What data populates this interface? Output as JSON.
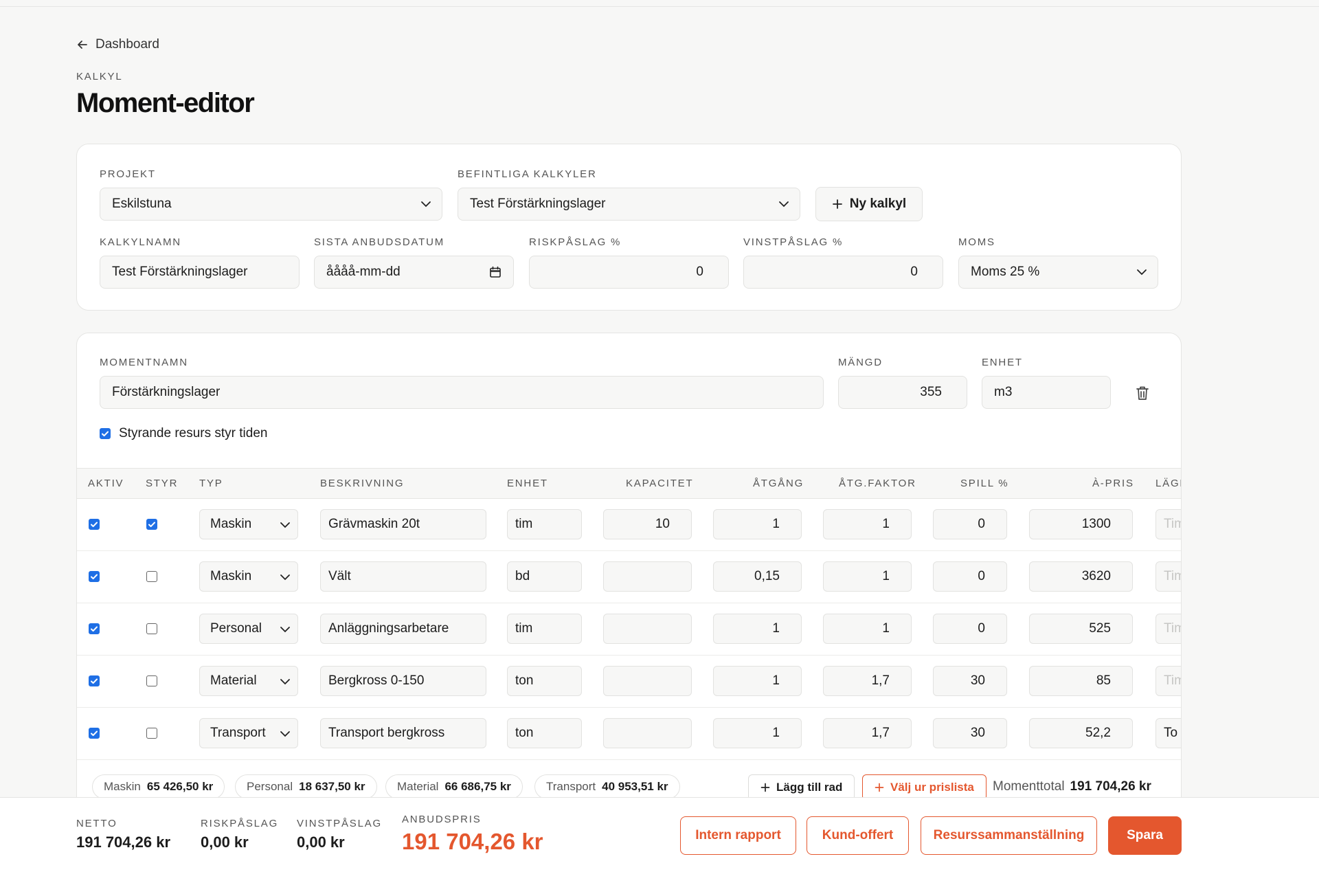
{
  "nav": {
    "back_label": "Dashboard"
  },
  "header": {
    "eyebrow": "KALKYL",
    "title": "Moment-editor"
  },
  "settings": {
    "project_label": "PROJEKT",
    "project_value": "Eskilstuna",
    "existing_label": "BEFINTLIGA KALKYLER",
    "existing_value": "Test Förstärkningslager",
    "new_button": "Ny kalkyl",
    "name_label": "KALKYLNAMN",
    "name_value": "Test Förstärkningslager",
    "date_label": "SISTA ANBUDSDATUM",
    "date_placeholder": "åååå-mm-dd",
    "risk_label": "RISKPÅSLAG %",
    "risk_value": "0",
    "profit_label": "VINSTPÅSLAG %",
    "profit_value": "0",
    "vat_label": "MOMS",
    "vat_value": "Moms 25 %"
  },
  "moment": {
    "name_label": "MOMENTNAMN",
    "name_value": "Förstärkningslager",
    "qty_label": "MÄNGD",
    "qty_value": "355",
    "unit_label": "ENHET",
    "unit_value": "m3",
    "steering_label": "Styrande resurs styr tiden",
    "steering_checked": true
  },
  "table": {
    "headers": {
      "aktiv": "AKTIV",
      "styr": "STYR",
      "typ": "TYP",
      "beskrivning": "BESKRIVNING",
      "enhet": "ENHET",
      "kapacitet": "KAPACITET",
      "atgang": "ÅTGÅNG",
      "atgfaktor": "ÅTG.FAKTOR",
      "spill": "SPILL %",
      "apris": "À-PRIS",
      "lage": "LÄGE"
    },
    "rows": [
      {
        "aktiv": true,
        "styr": true,
        "typ": "Maskin",
        "beskrivning": "Grävmaskin 20t",
        "enhet": "tim",
        "kapacitet": "10",
        "atgang": "1",
        "atgfaktor": "1",
        "spill": "0",
        "apris": "1300",
        "lage": "Tim"
      },
      {
        "aktiv": true,
        "styr": false,
        "typ": "Maskin",
        "beskrivning": "Vält",
        "enhet": "bd",
        "kapacitet": "",
        "atgang": "0,15",
        "atgfaktor": "1",
        "spill": "0",
        "apris": "3620",
        "lage": "Tim"
      },
      {
        "aktiv": true,
        "styr": false,
        "typ": "Personal",
        "beskrivning": "Anläggningsarbetare",
        "enhet": "tim",
        "kapacitet": "",
        "atgang": "1",
        "atgfaktor": "1",
        "spill": "0",
        "apris": "525",
        "lage": "Tim"
      },
      {
        "aktiv": true,
        "styr": false,
        "typ": "Material",
        "beskrivning": "Bergkross 0-150",
        "enhet": "ton",
        "kapacitet": "",
        "atgang": "1",
        "atgfaktor": "1,7",
        "spill": "30",
        "apris": "85",
        "lage": "Tim"
      },
      {
        "aktiv": true,
        "styr": false,
        "typ": "Transport",
        "beskrivning": "Transport bergkross",
        "enhet": "ton",
        "kapacitet": "",
        "atgang": "1",
        "atgfaktor": "1,7",
        "spill": "30",
        "apris": "52,2",
        "lage": "To"
      }
    ]
  },
  "summary": {
    "pills": [
      {
        "label": "Maskin",
        "value": "65 426,50 kr"
      },
      {
        "label": "Personal",
        "value": "18 637,50 kr"
      },
      {
        "label": "Material",
        "value": "66 686,75 kr"
      },
      {
        "label": "Transport",
        "value": "40 953,51 kr"
      }
    ],
    "add_row": "Lägg till rad",
    "from_pricelist": "Välj ur prislista",
    "total_label": "Momenttotal",
    "total_value": "191 704,26 kr"
  },
  "footer": {
    "netto_label": "NETTO",
    "netto_value": "191 704,26 kr",
    "risk_label": "RISKPÅSLAG",
    "risk_value": "0,00 kr",
    "profit_label": "VINSTPÅSLAG",
    "profit_value": "0,00 kr",
    "bid_label": "ANBUDSPRIS",
    "bid_value": "191 704,26 kr",
    "btn_internal": "Intern rapport",
    "btn_customer": "Kund-offert",
    "btn_resources": "Resurssammanställning",
    "btn_save": "Spara"
  },
  "colors": {
    "accent": "#e4572e",
    "checkbox": "#1f6fe5",
    "background": "#f7f7f6"
  }
}
